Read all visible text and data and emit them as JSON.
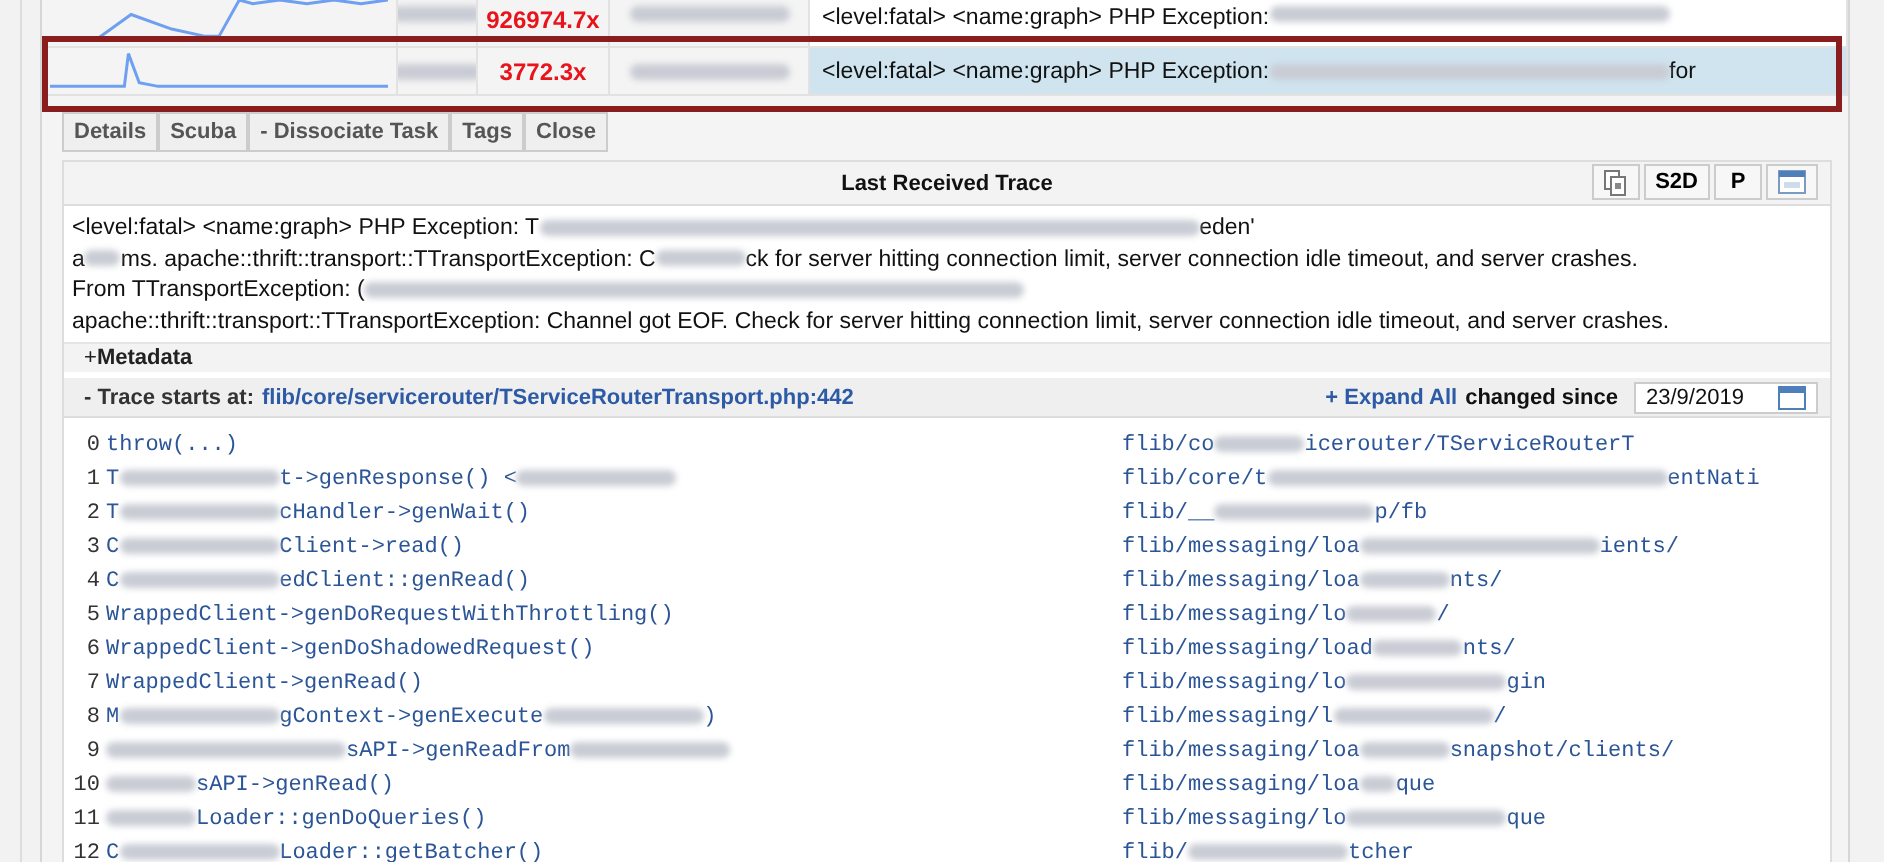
{
  "issues": [
    {
      "selected": false,
      "count": [
        {
          "kind": "redacted"
        }
      ],
      "ratio": "926974.7x",
      "owner": [
        {
          "kind": "redacted"
        }
      ],
      "message": [
        {
          "kind": "text",
          "text": "<level:fatal> <name:graph> PHP Exception: "
        },
        {
          "kind": "redacted"
        }
      ]
    },
    {
      "selected": true,
      "count": [
        {
          "kind": "redacted"
        }
      ],
      "ratio": "3772.3x",
      "owner": [
        {
          "kind": "redacted"
        }
      ],
      "message": [
        {
          "kind": "text",
          "text": "<level:fatal> <name:graph> PHP Exception: "
        },
        {
          "kind": "redacted"
        },
        {
          "kind": "text",
          "text": " for"
        }
      ]
    }
  ],
  "actions": [
    "Details",
    "Scuba",
    "- Dissociate Task",
    "Tags",
    "Close"
  ],
  "trace_panel": {
    "title": "Last Received Trace",
    "tools": [
      {
        "kind": "icon"
      },
      {
        "kind": "text",
        "label": "S2D"
      },
      {
        "kind": "text",
        "label": "P"
      },
      {
        "kind": "icon"
      }
    ],
    "message_lines": [
      [
        {
          "kind": "text",
          "text": "<level:fatal> <name:graph> PHP Exception: T"
        },
        {
          "kind": "redacted"
        },
        {
          "kind": "text",
          "text": "eden'"
        }
      ],
      [
        {
          "kind": "text",
          "text": "a"
        },
        {
          "kind": "redacted"
        },
        {
          "kind": "text",
          "text": "ms. apache::thrift::transport::TTransportException: C"
        },
        {
          "kind": "redacted"
        },
        {
          "kind": "text",
          "text": "ck for server hitting connection limit, server connection idle timeout, and server crashes."
        }
      ],
      [
        {
          "kind": "text",
          "text": "From TTransportException: ("
        },
        {
          "kind": "redacted"
        }
      ],
      [
        {
          "kind": "text",
          "text": "apache::thrift::transport::TTransportException: Channel got EOF. Check for server hitting connection limit, server connection idle timeout, and server crashes."
        }
      ]
    ],
    "metadata": {
      "toggle": "+",
      "label": "Metadata"
    },
    "trace_header": {
      "toggle": "-",
      "label": "Trace starts at:",
      "link": "flib/core/servicerouter/TServiceRouterTransport.php:442",
      "expand": "+ Expand All",
      "changed_label": "changed since",
      "date": "23/9/2019"
    },
    "frames": [
      {
        "index": "0",
        "call": [
          {
            "kind": "text",
            "text": "throw(...)"
          }
        ],
        "file": [
          {
            "kind": "text",
            "text": "flib/co"
          },
          {
            "kind": "redacted"
          },
          {
            "kind": "text",
            "text": "icerouter/TServiceRouterT"
          }
        ]
      },
      {
        "index": "1",
        "call": [
          {
            "kind": "text",
            "text": "T"
          },
          {
            "kind": "redacted"
          },
          {
            "kind": "text",
            "text": "t->genResponse() <"
          },
          {
            "kind": "redacted"
          }
        ],
        "file": [
          {
            "kind": "text",
            "text": "flib/core/t"
          },
          {
            "kind": "redacted"
          },
          {
            "kind": "text",
            "text": "entNati"
          }
        ]
      },
      {
        "index": "2",
        "call": [
          {
            "kind": "text",
            "text": "T"
          },
          {
            "kind": "redacted"
          },
          {
            "kind": "text",
            "text": "cHandler->genWait()"
          }
        ],
        "file": [
          {
            "kind": "text",
            "text": "flib/__"
          },
          {
            "kind": "redacted"
          },
          {
            "kind": "text",
            "text": "p/fb"
          }
        ]
      },
      {
        "index": "3",
        "call": [
          {
            "kind": "text",
            "text": "C"
          },
          {
            "kind": "redacted"
          },
          {
            "kind": "text",
            "text": "Client->read()"
          }
        ],
        "file": [
          {
            "kind": "text",
            "text": "flib/messaging/loa"
          },
          {
            "kind": "redacted"
          },
          {
            "kind": "text",
            "text": "ients/"
          }
        ]
      },
      {
        "index": "4",
        "call": [
          {
            "kind": "text",
            "text": "C"
          },
          {
            "kind": "redacted"
          },
          {
            "kind": "text",
            "text": "edClient::genRead()"
          }
        ],
        "file": [
          {
            "kind": "text",
            "text": "flib/messaging/loa"
          },
          {
            "kind": "redacted"
          },
          {
            "kind": "text",
            "text": "nts/"
          }
        ]
      },
      {
        "index": "5",
        "call": [
          {
            "kind": "text",
            "text": "WrappedClient->genDoRequestWithThrottling()"
          }
        ],
        "file": [
          {
            "kind": "text",
            "text": "flib/messaging/lo"
          },
          {
            "kind": "redacted"
          },
          {
            "kind": "text",
            "text": "/"
          }
        ]
      },
      {
        "index": "6",
        "call": [
          {
            "kind": "text",
            "text": "WrappedClient->genDoShadowedRequest()"
          }
        ],
        "file": [
          {
            "kind": "text",
            "text": "flib/messaging/load"
          },
          {
            "kind": "redacted"
          },
          {
            "kind": "text",
            "text": "nts/"
          }
        ]
      },
      {
        "index": "7",
        "call": [
          {
            "kind": "text",
            "text": "WrappedClient->genRead()"
          }
        ],
        "file": [
          {
            "kind": "text",
            "text": "flib/messaging/lo"
          },
          {
            "kind": "redacted"
          },
          {
            "kind": "text",
            "text": "gin"
          }
        ]
      },
      {
        "index": "8",
        "call": [
          {
            "kind": "text",
            "text": "M"
          },
          {
            "kind": "redacted"
          },
          {
            "kind": "text",
            "text": "gContext->genExecute"
          },
          {
            "kind": "redacted"
          },
          {
            "kind": "text",
            "text": ")"
          }
        ],
        "file": [
          {
            "kind": "text",
            "text": "flib/messaging/l"
          },
          {
            "kind": "redacted"
          },
          {
            "kind": "text",
            "text": "/"
          }
        ]
      },
      {
        "index": "9",
        "call": [
          {
            "kind": "redacted"
          },
          {
            "kind": "text",
            "text": "sAPI->genReadFrom"
          },
          {
            "kind": "redacted"
          }
        ],
        "file": [
          {
            "kind": "text",
            "text": "flib/messaging/loa"
          },
          {
            "kind": "redacted"
          },
          {
            "kind": "text",
            "text": "snapshot/clients/"
          }
        ]
      },
      {
        "index": "10",
        "call": [
          {
            "kind": "redacted"
          },
          {
            "kind": "text",
            "text": "sAPI->genRead()"
          }
        ],
        "file": [
          {
            "kind": "text",
            "text": "flib/messaging/loa"
          },
          {
            "kind": "redacted"
          },
          {
            "kind": "text",
            "text": "que"
          }
        ]
      },
      {
        "index": "11",
        "call": [
          {
            "kind": "redacted"
          },
          {
            "kind": "text",
            "text": "Loader::genDoQueries()"
          }
        ],
        "file": [
          {
            "kind": "text",
            "text": "flib/messaging/lo"
          },
          {
            "kind": "redacted"
          },
          {
            "kind": "text",
            "text": "que"
          }
        ]
      },
      {
        "index": "12",
        "call": [
          {
            "kind": "text",
            "text": "C"
          },
          {
            "kind": "redacted"
          },
          {
            "kind": "text",
            "text": "Loader::getBatcher()"
          }
        ],
        "file": [
          {
            "kind": "text",
            "text": "flib/"
          },
          {
            "kind": "redacted"
          },
          {
            "kind": "text",
            "text": "tcher"
          }
        ]
      }
    ]
  }
}
